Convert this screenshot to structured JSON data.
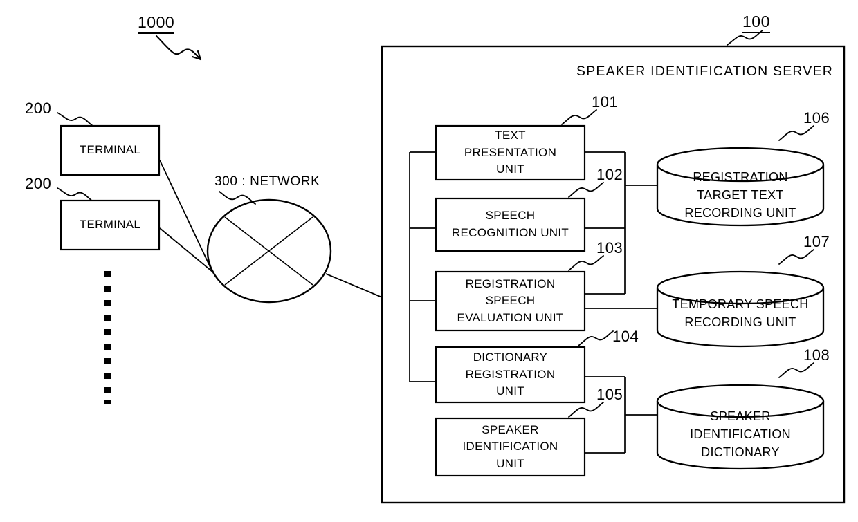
{
  "figure": {
    "system_ref": "1000",
    "network_label": "300 : NETWORK",
    "server": {
      "ref": "100",
      "title": "SPEAKER IDENTIFICATION SERVER"
    },
    "terminals": [
      {
        "ref": "200",
        "label": "TERMINAL"
      },
      {
        "ref": "200",
        "label": "TERMINAL"
      }
    ],
    "ellipsis_marker": "vertical-dotted-continuation",
    "units": [
      {
        "ref": "101",
        "lines": [
          "TEXT",
          "PRESENTATION",
          "UNIT"
        ]
      },
      {
        "ref": "102",
        "lines": [
          "SPEECH",
          "RECOGNITION UNIT"
        ]
      },
      {
        "ref": "103",
        "lines": [
          "REGISTRATION",
          "SPEECH",
          "EVALUATION UNIT"
        ]
      },
      {
        "ref": "104",
        "lines": [
          "DICTIONARY",
          "REGISTRATION",
          "UNIT"
        ]
      },
      {
        "ref": "105",
        "lines": [
          "SPEAKER",
          "IDENTIFICATION",
          "UNIT"
        ]
      }
    ],
    "stores": [
      {
        "ref": "106",
        "lines": [
          "REGISTRATION",
          "TARGET TEXT",
          "RECORDING UNIT"
        ]
      },
      {
        "ref": "107",
        "lines": [
          "TEMPORARY SPEECH",
          "RECORDING UNIT"
        ]
      },
      {
        "ref": "108",
        "lines": [
          "SPEAKER",
          "IDENTIFICATION",
          "DICTIONARY"
        ]
      }
    ],
    "colors": {
      "ink": "#000000",
      "background": "#ffffff"
    }
  }
}
